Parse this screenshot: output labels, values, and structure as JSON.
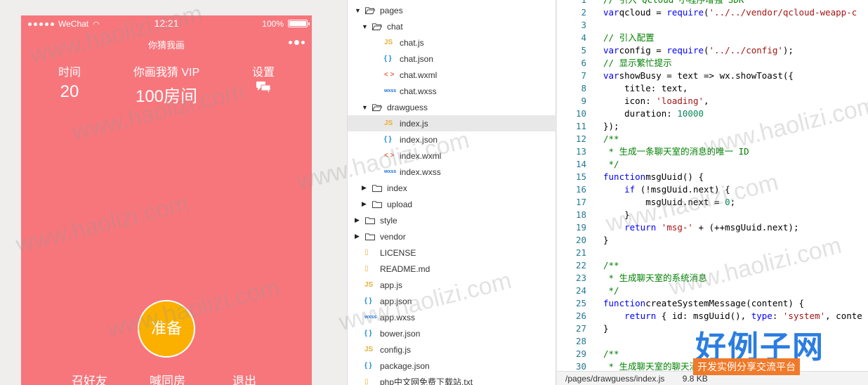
{
  "phone": {
    "status": {
      "carrier": "WeChat",
      "time": "12:21",
      "battery": "100%"
    },
    "nav": {
      "title": "你猜我画"
    },
    "stats": {
      "time_label": "时间",
      "time_value": "20",
      "vip_label": "你画我猜 VIP",
      "vip_value": "100房间",
      "settings_label": "设置"
    },
    "ready_label": "准备",
    "actions": {
      "invite": "召好友",
      "shout": "喊同房",
      "exit": "退出"
    },
    "bg_color": "#f7767c",
    "button_color": "#fbb000"
  },
  "tree": {
    "items": [
      {
        "label": "pages",
        "type": "folder",
        "open": true,
        "depth": 0
      },
      {
        "label": "chat",
        "type": "folder",
        "open": true,
        "depth": 1
      },
      {
        "label": "chat.js",
        "type": "js",
        "depth": 2
      },
      {
        "label": "chat.json",
        "type": "json",
        "depth": 2
      },
      {
        "label": "chat.wxml",
        "type": "wxml",
        "depth": 2
      },
      {
        "label": "chat.wxss",
        "type": "wxss",
        "depth": 2
      },
      {
        "label": "drawguess",
        "type": "folder",
        "open": true,
        "depth": 1
      },
      {
        "label": "index.js",
        "type": "js",
        "depth": 2,
        "selected": true
      },
      {
        "label": "index.json",
        "type": "json",
        "depth": 2
      },
      {
        "label": "index.wxml",
        "type": "wxml",
        "depth": 2
      },
      {
        "label": "index.wxss",
        "type": "wxss",
        "depth": 2
      },
      {
        "label": "index",
        "type": "folder",
        "open": false,
        "depth": 1
      },
      {
        "label": "upload",
        "type": "folder",
        "open": false,
        "depth": 1
      },
      {
        "label": "style",
        "type": "folder",
        "open": false,
        "depth": 0
      },
      {
        "label": "vendor",
        "type": "folder",
        "open": false,
        "depth": 0
      },
      {
        "label": "LICENSE",
        "type": "doc",
        "depth": 0
      },
      {
        "label": "README.md",
        "type": "doc",
        "depth": 0
      },
      {
        "label": "app.js",
        "type": "js",
        "depth": 0
      },
      {
        "label": "app.json",
        "type": "json",
        "depth": 0
      },
      {
        "label": "app.wxss",
        "type": "wxss",
        "depth": 0
      },
      {
        "label": "bower.json",
        "type": "json",
        "depth": 0
      },
      {
        "label": "config.js",
        "type": "js",
        "depth": 0
      },
      {
        "label": "package.json",
        "type": "json",
        "depth": 0
      },
      {
        "label": "php中文网免费下载站.txt",
        "type": "doc",
        "depth": 0
      }
    ]
  },
  "editor": {
    "lines": [
      [
        [
          "cm",
          "// 引入 QCloud 小程序增强 SDK"
        ]
      ],
      [
        [
          "kw",
          "var"
        ],
        [
          "",
          "qcloud = "
        ],
        [
          "kw",
          "require"
        ],
        [
          "",
          "("
        ],
        [
          "str",
          "'../../vendor/qcloud-weapp-c"
        ]
      ],
      [],
      [
        [
          "cm",
          "// 引入配置"
        ]
      ],
      [
        [
          "kw",
          "var"
        ],
        [
          "",
          "config = "
        ],
        [
          "kw",
          "require"
        ],
        [
          "",
          "("
        ],
        [
          "str",
          "'../../config'"
        ],
        [
          "",
          ");"
        ]
      ],
      [
        [
          "cm",
          "// 显示繁忙提示"
        ]
      ],
      [
        [
          "kw",
          "var"
        ],
        [
          "",
          "showBusy = text => wx.showToast({"
        ]
      ],
      [
        [
          "",
          "    title: text,"
        ]
      ],
      [
        [
          "",
          "    icon: "
        ],
        [
          "str",
          "'loading'"
        ],
        [
          "",
          ","
        ]
      ],
      [
        [
          "",
          "    duration: "
        ],
        [
          "num",
          "10000"
        ]
      ],
      [
        [
          "",
          "});"
        ]
      ],
      [
        [
          "cm",
          "/**"
        ]
      ],
      [
        [
          "cm",
          " * 生成一条聊天室的消息的唯一 ID"
        ]
      ],
      [
        [
          "cm",
          " */"
        ]
      ],
      [
        [
          "kw",
          "function"
        ],
        [
          "",
          "msgUuid() {"
        ]
      ],
      [
        [
          "",
          "    "
        ],
        [
          "kw",
          "if"
        ],
        [
          "",
          " (!msgUuid.next) {"
        ]
      ],
      [
        [
          "",
          "        msgUuid.next = "
        ],
        [
          "num",
          "0"
        ],
        [
          "",
          ";"
        ]
      ],
      [
        [
          "",
          "    }"
        ]
      ],
      [
        [
          "",
          "    "
        ],
        [
          "kw",
          "return"
        ],
        [
          "",
          ""
        ],
        [
          "str",
          " 'msg-'"
        ],
        [
          "",
          " + (++msgUuid.next);"
        ]
      ],
      [
        [
          "",
          "}"
        ]
      ],
      [],
      [
        [
          "cm",
          "/**"
        ]
      ],
      [
        [
          "cm",
          " * 生成聊天室的系统消息"
        ]
      ],
      [
        [
          "cm",
          " */"
        ]
      ],
      [
        [
          "kw",
          "function"
        ],
        [
          "",
          "createSystemMessage(content) {"
        ]
      ],
      [
        [
          "",
          "    "
        ],
        [
          "kw",
          "return"
        ],
        [
          "",
          " { id: msgUuid(), "
        ],
        [
          "kw",
          "type"
        ],
        [
          "",
          ": "
        ],
        [
          "str",
          "'system'"
        ],
        [
          "",
          ", conte"
        ]
      ],
      [
        [
          "",
          "}"
        ]
      ],
      [],
      [
        [
          "cm",
          "/**"
        ]
      ],
      [
        [
          "cm",
          " * 生成聊天室的聊天消息"
        ]
      ]
    ],
    "status": {
      "path": "/pages/drawguess/index.js",
      "size": "9.8 KB"
    }
  },
  "watermark": {
    "text": "www.haolizi.com",
    "logo": "好例子网",
    "tagline": "开发实例分享交流平台"
  }
}
